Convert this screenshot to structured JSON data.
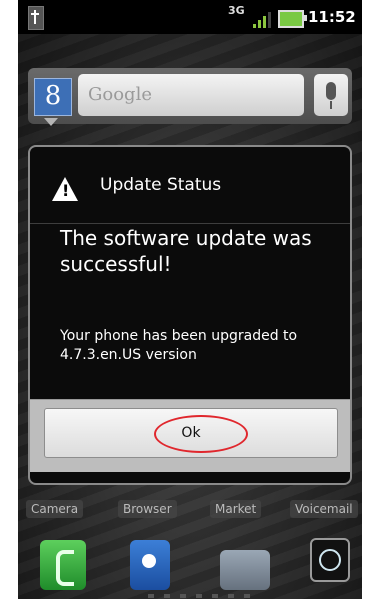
{
  "status_bar": {
    "network_type": "3G",
    "time": "11:52"
  },
  "search_widget": {
    "placeholder": "Google",
    "icons": [
      "google-g-icon",
      "mic-icon"
    ]
  },
  "dialog": {
    "title": "Update Status",
    "message": "The software update was successful!",
    "detail": "Your phone has been upgraded to 4.7.3.en.US version",
    "ok_label": "Ok",
    "icon": "warning-icon"
  },
  "dock": {
    "labels": [
      "Camera",
      "Browser",
      "Market",
      "Voicemail"
    ],
    "icons": [
      "phone-icon",
      "contacts-icon",
      "messaging-icon",
      "launcher-icon"
    ]
  },
  "colors": {
    "highlight": "#e0272d",
    "dialog_background": "#0b0b0b",
    "button_bar": "#bdbdbd"
  }
}
